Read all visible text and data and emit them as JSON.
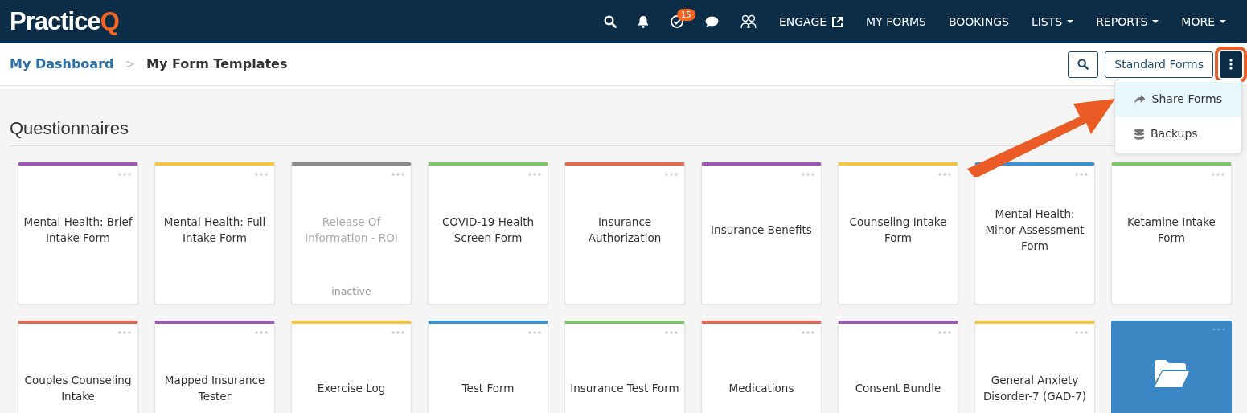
{
  "navbar": {
    "logo": {
      "text": "Practice",
      "accent": "Q"
    },
    "icons": [
      {
        "kind": "search"
      },
      {
        "kind": "bell"
      },
      {
        "kind": "tasks",
        "badge": "15"
      },
      {
        "kind": "chat"
      },
      {
        "kind": "people"
      }
    ],
    "links": [
      {
        "label": "ENGAGE",
        "external": true,
        "dropdown": false
      },
      {
        "label": "MY FORMS",
        "external": false,
        "dropdown": false
      },
      {
        "label": "BOOKINGS",
        "external": false,
        "dropdown": false
      },
      {
        "label": "LISTS",
        "external": false,
        "dropdown": true
      },
      {
        "label": "REPORTS",
        "external": false,
        "dropdown": true
      },
      {
        "label": "MORE",
        "external": false,
        "dropdown": true
      }
    ]
  },
  "breadcrumb": [
    {
      "label": "My Dashboard",
      "link": true
    },
    {
      "label": ">",
      "link": false
    },
    {
      "label": "My Form Templates",
      "link": false
    }
  ],
  "toolbar": {
    "standard_button": "Standard Forms",
    "menu_highlighted": true,
    "menu": [
      {
        "label": "Share Forms",
        "kind": "share",
        "selected": true
      },
      {
        "label": "Backups",
        "kind": "database",
        "selected": false
      }
    ]
  },
  "section_title": "Questionnaires",
  "cards": [
    {
      "kind": "form",
      "title": "Mental Health: Brief Intake Form",
      "color": "#9b59b6",
      "inactive": false
    },
    {
      "kind": "form",
      "title": "Mental Health: Full Intake Form",
      "color": "#f4c542",
      "inactive": false
    },
    {
      "kind": "form",
      "title": "Release Of Information - ROI",
      "color": "#8c8c8c",
      "inactive": true,
      "status": "inactive"
    },
    {
      "kind": "form",
      "title": "COVID-19 Health Screen Form",
      "color": "#7dc46a",
      "inactive": false
    },
    {
      "kind": "form",
      "title": "Insurance Authorization",
      "color": "#e06a55",
      "inactive": false
    },
    {
      "kind": "form",
      "title": "Insurance Benefits",
      "color": "#9b59b6",
      "inactive": false
    },
    {
      "kind": "form",
      "title": "Counseling Intake Form",
      "color": "#f4c542",
      "inactive": false
    },
    {
      "kind": "form",
      "title": "Mental Health: Minor Assessment Form",
      "color": "#3a91d3",
      "inactive": false
    },
    {
      "kind": "form",
      "title": "Ketamine Intake Form",
      "color": "#7dc46a",
      "inactive": false
    },
    {
      "kind": "form",
      "title": "Couples Counseling Intake",
      "color": "#e06a55",
      "inactive": false
    },
    {
      "kind": "form",
      "title": "Mapped Insurance Tester",
      "color": "#9b59b6",
      "inactive": false
    },
    {
      "kind": "form",
      "title": "Exercise Log",
      "color": "#f4c542",
      "inactive": false
    },
    {
      "kind": "form",
      "title": "Test Form",
      "color": "#3a91d3",
      "inactive": false
    },
    {
      "kind": "form",
      "title": "Insurance Test Form",
      "color": "#7dc46a",
      "inactive": false
    },
    {
      "kind": "form",
      "title": "Medications",
      "color": "#e06a55",
      "inactive": false
    },
    {
      "kind": "form",
      "title": "Consent Bundle",
      "color": "#9b59b6",
      "inactive": false
    },
    {
      "kind": "form",
      "title": "General Anxiety Disorder-7 (GAD-7)",
      "color": "#f4c542",
      "inactive": false
    },
    {
      "kind": "folder",
      "color": "#3a87c3"
    }
  ]
}
